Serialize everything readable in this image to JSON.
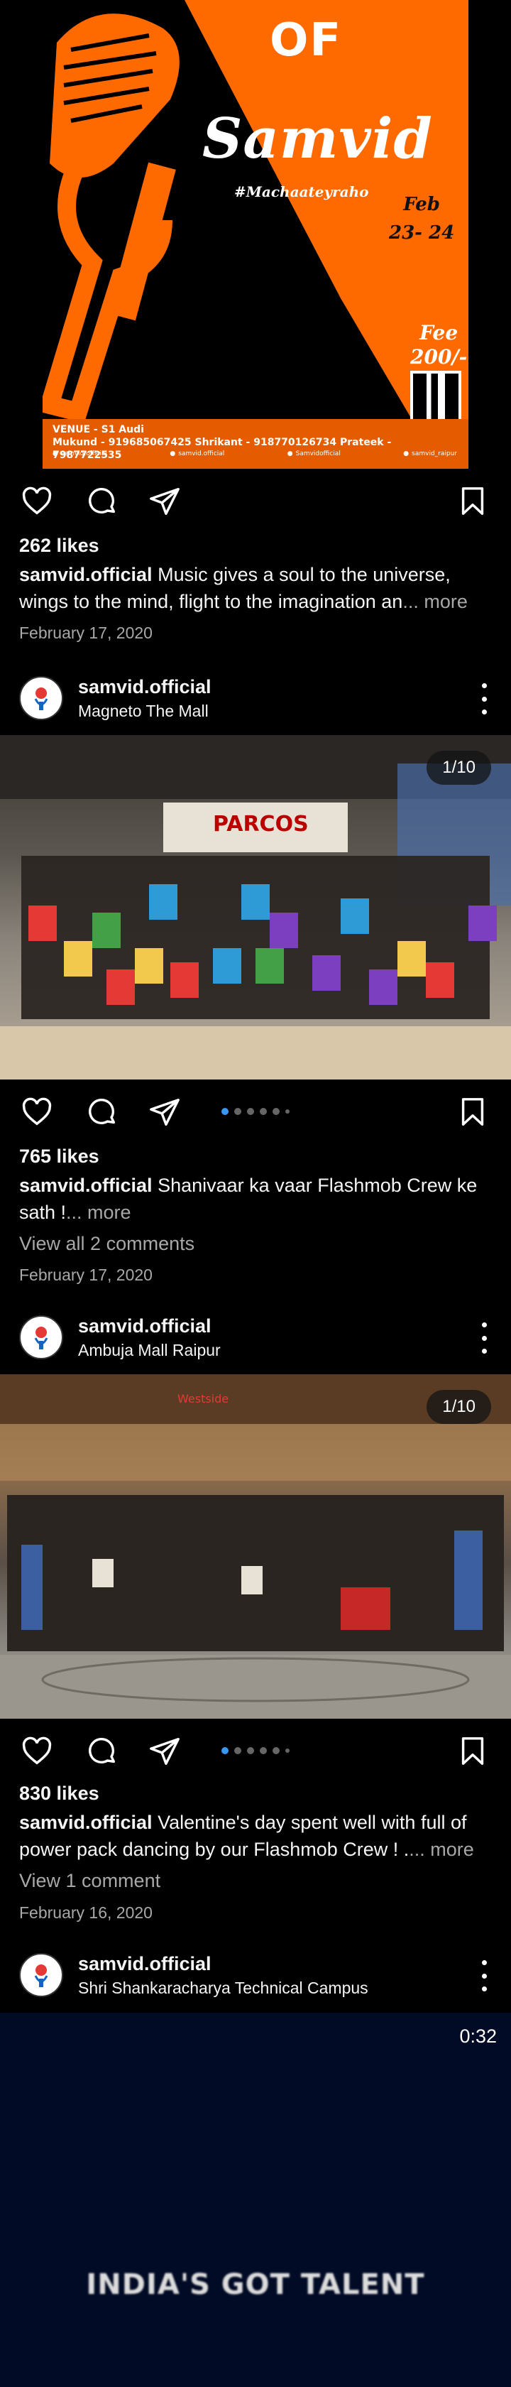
{
  "posts": [
    {
      "poster": {
        "of": "OF",
        "samvid": "Samvid",
        "hashtag": "#Machaateyraho",
        "date_month": "Feb",
        "date_days": "23- 24",
        "fee_label": "Fee",
        "fee_value": "200/-",
        "venue_line1": "VENUE -  S1 Audi",
        "venue_line2": "Mukund - 919685067425  Shrikant - 918770126734   Prateek - 7987722535",
        "social1": "samvid.official",
        "social2": "samvid.official",
        "social3": "Samvidofficial",
        "social4": "samvid_raipur"
      },
      "likes": "262 likes",
      "username": "samvid.official",
      "caption": "Music gives a soul to the universe, wings to the mind, flight to the imagination an",
      "more": "... more",
      "date": "February 17, 2020"
    },
    {
      "header": {
        "username": "samvid.official",
        "location": "Magneto The Mall"
      },
      "counter": "1/10",
      "likes": "765 likes",
      "username": "samvid.official",
      "caption": "Shanivaar ka vaar Flashmob Crew ke sath !",
      "more": "... more",
      "comments": "View all 2 comments",
      "date": "February 17, 2020"
    },
    {
      "header": {
        "username": "samvid.official",
        "location": "Ambuja Mall Raipur"
      },
      "counter": "1/10",
      "likes": "830 likes",
      "username": "samvid.official",
      "caption": "Valentine's day spent well with full of power pack dancing by our Flashmob Crew ! .",
      "more": "... more",
      "comments": "View 1 comment",
      "date": "February 16, 2020"
    },
    {
      "header": {
        "username": "samvid.official",
        "location": "Shri Shankaracharya Technical Campus"
      }
    }
  ],
  "reel": {
    "time": "0:32",
    "title": "INDIA'S GOT TALENT"
  },
  "colors": {
    "accent": "#3897f0",
    "poster_orange": "#ff6a00",
    "reel_bg": "#020b26"
  }
}
